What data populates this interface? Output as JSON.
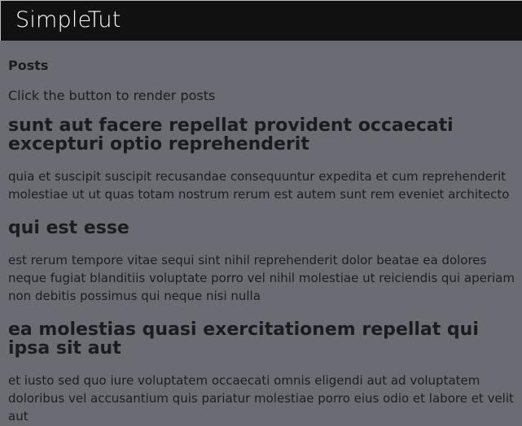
{
  "header": {
    "brand": "SimpleTut"
  },
  "main": {
    "section_label": "Posts",
    "instructions": "Click the button to render posts",
    "posts": [
      {
        "title": "sunt aut facere repellat provident occaecati excepturi optio reprehenderit",
        "body": "quia et suscipit suscipit recusandae consequuntur expedita et cum reprehenderit molestiae ut ut quas totam nostrum rerum est autem sunt rem eveniet architecto"
      },
      {
        "title": "qui est esse",
        "body": "est rerum tempore vitae sequi sint nihil reprehenderit dolor beatae ea dolores neque fugiat blanditiis voluptate porro vel nihil molestiae ut reiciendis qui aperiam non debitis possimus qui neque nisi nulla"
      },
      {
        "title": "ea molestias quasi exercitationem repellat qui ipsa sit aut",
        "body": "et iusto sed quo iure voluptatem occaecati omnis eligendi aut ad voluptatem doloribus vel accusantium quis pariatur molestiae porro eius odio et labore et velit aut"
      }
    ]
  }
}
